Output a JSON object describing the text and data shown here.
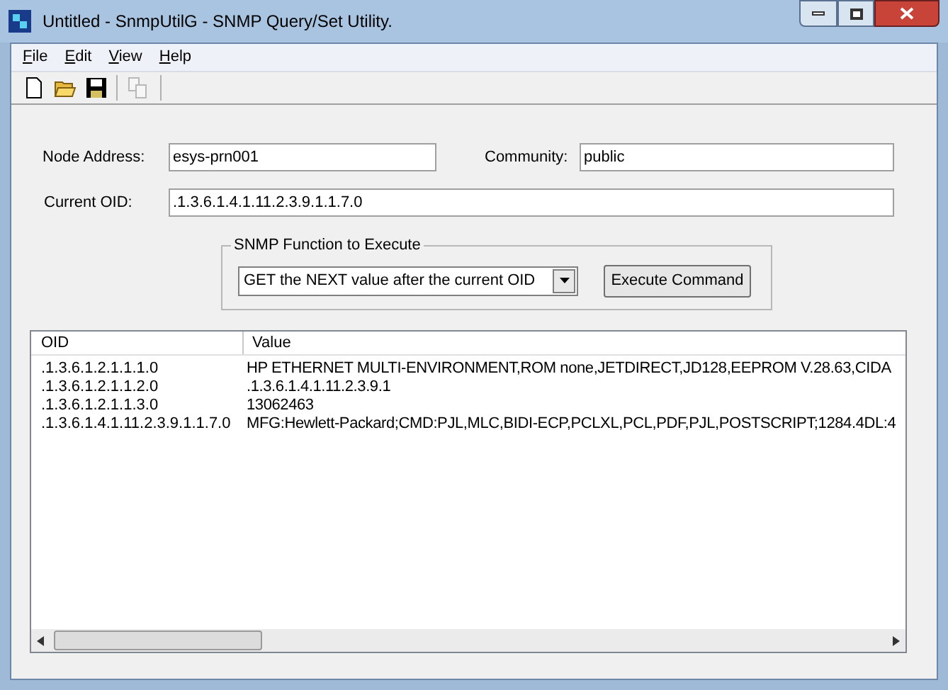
{
  "window": {
    "title": "Untitled - SnmpUtilG - SNMP Query/Set Utility."
  },
  "menu": [
    "File",
    "Edit",
    "View",
    "Help"
  ],
  "toolbar": [
    {
      "kind": "new",
      "disabled": false
    },
    {
      "kind": "open",
      "disabled": false
    },
    {
      "kind": "save",
      "disabled": false
    },
    {
      "kind": "copy",
      "disabled": true
    }
  ],
  "form": {
    "node_address": {
      "label": "Node Address:",
      "value": "esys-prn001"
    },
    "community": {
      "label": "Community:",
      "value": "public"
    },
    "current_oid": {
      "label": "Current OID:",
      "value": ".1.3.6.1.4.1.11.2.3.9.1.1.7.0"
    },
    "function_group": {
      "title": "SNMP Function to Execute",
      "selected_function": "GET the NEXT value after the current OID",
      "button": "Execute Command"
    }
  },
  "table": {
    "columns": [
      "OID",
      "Value"
    ],
    "rows": [
      [
        ".1.3.6.1.2.1.1.1.0",
        "HP ETHERNET MULTI-ENVIRONMENT,ROM none,JETDIRECT,JD128,EEPROM V.28.63,CIDA"
      ],
      [
        ".1.3.6.1.2.1.1.2.0",
        ".1.3.6.1.4.1.11.2.3.9.1"
      ],
      [
        ".1.3.6.1.2.1.1.3.0",
        "13062463"
      ],
      [
        ".1.3.6.1.4.1.11.2.3.9.1.1.7.0",
        "MFG:Hewlett-Packard;CMD:PJL,MLC,BIDI-ECP,PCLXL,PCL,PDF,PJL,POSTSCRIPT;1284.4DL:4"
      ]
    ]
  }
}
